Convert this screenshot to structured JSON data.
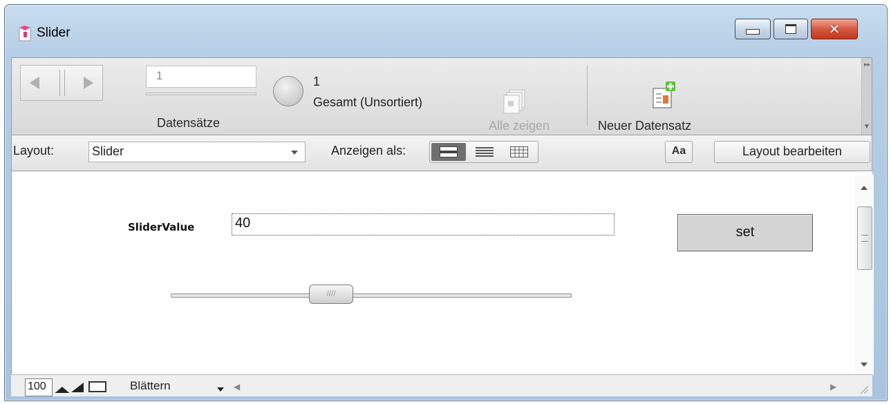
{
  "window": {
    "title": "Slider",
    "controls": [
      "minimize-icon",
      "maximize-icon",
      "close-icon"
    ]
  },
  "toolbar": {
    "record_number": "1",
    "records_label": "Datensätze",
    "found_count": "1",
    "found_status": "Gesamt (Unsortiert)",
    "show_all_label": "Alle zeigen",
    "new_record_label": "Neuer Datensatz"
  },
  "layout_bar": {
    "layout_label": "Layout:",
    "layout_value": "Slider",
    "view_as_label": "Anzeigen als:",
    "view_modes": [
      "form-view-icon",
      "list-view-icon",
      "table-view-icon"
    ],
    "active_view": "form",
    "format_button": "Aa",
    "edit_layout_button": "Layout bearbeiten"
  },
  "content": {
    "field_label": "SliderValue",
    "field_value": "40",
    "set_button": "set",
    "slider": {
      "value": 40,
      "min": 0,
      "max": 100
    }
  },
  "status_bar": {
    "zoom": "100",
    "mode": "Blättern"
  },
  "colors": {
    "window_frame": "#b6cee6",
    "close_button": "#d4543a",
    "toolbar_bg": "#e2e2e2"
  }
}
